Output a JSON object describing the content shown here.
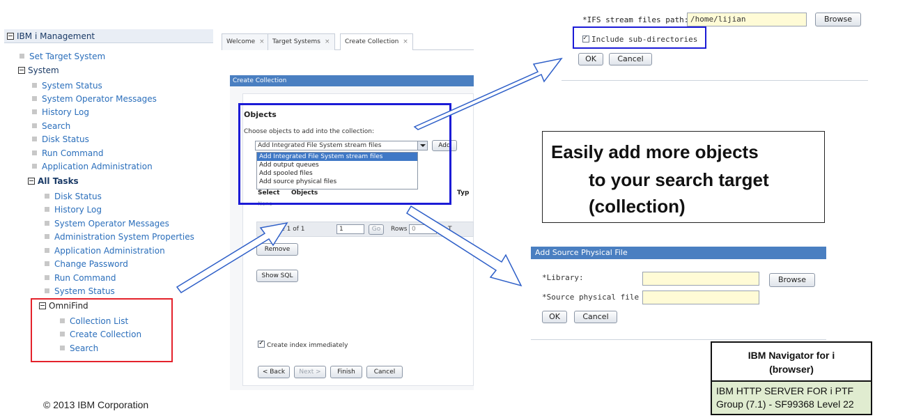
{
  "nav": {
    "header": "IBM i Management",
    "items": [
      {
        "label": "Set Target System",
        "kind": "link"
      },
      {
        "label": "System",
        "kind": "head"
      },
      {
        "label": "System Status",
        "kind": "link"
      },
      {
        "label": "System Operator Messages",
        "kind": "link"
      },
      {
        "label": "History Log",
        "kind": "link"
      },
      {
        "label": "Search",
        "kind": "link"
      },
      {
        "label": "Disk Status",
        "kind": "link"
      },
      {
        "label": "Run Command",
        "kind": "link"
      },
      {
        "label": "Application Administration",
        "kind": "link"
      },
      {
        "label": "All Tasks",
        "kind": "head"
      },
      {
        "label": "Disk Status",
        "kind": "link"
      },
      {
        "label": "History Log",
        "kind": "link"
      },
      {
        "label": "System Operator Messages",
        "kind": "link"
      },
      {
        "label": "Administration System Properties",
        "kind": "link"
      },
      {
        "label": "Application Administration",
        "kind": "link"
      },
      {
        "label": "Change Password",
        "kind": "link"
      },
      {
        "label": "Run Command",
        "kind": "link"
      },
      {
        "label": "System Status",
        "kind": "link"
      },
      {
        "label": "OmniFind",
        "kind": "head"
      },
      {
        "label": "Collection List",
        "kind": "link"
      },
      {
        "label": "Create Collection",
        "kind": "link"
      },
      {
        "label": "Search",
        "kind": "link"
      }
    ]
  },
  "wizard": {
    "tabs": [
      {
        "label": "Welcome"
      },
      {
        "label": "Target Systems"
      },
      {
        "label": "Create Collection"
      }
    ],
    "title": "Create Collection",
    "objects_heading": "Objects",
    "choose_label": "Choose objects to add into the collection:",
    "select_value": "Add Integrated File System stream files",
    "add_label": "Add",
    "dropdown_options": [
      "Add Integrated File System stream files",
      "Add output queues",
      "Add spooled files",
      "Add source physical files"
    ],
    "table_headers": [
      "Select",
      "Objects",
      "Typ"
    ],
    "table_empty": "None",
    "pager": {
      "page_text": "Page 1 of 1",
      "page_input": "1",
      "go_label": "Go",
      "rows_label": "Rows",
      "rows_value": "0",
      "total_label": "T"
    },
    "remove_label": "Remove",
    "show_sql_label": "Show SQL",
    "create_index_label": "Create index immediately",
    "create_index_checked": true,
    "footer": {
      "back": "< Back",
      "next": "Next >",
      "finish": "Finish",
      "cancel": "Cancel"
    }
  },
  "ifs": {
    "label": "*IFS stream files path:",
    "path_value": "/home/lijian",
    "browse_label": "Browse",
    "include_subdirs_label": "Include sub-directories",
    "include_subdirs_checked": true,
    "ok_label": "OK",
    "cancel_label": "Cancel"
  },
  "callout": {
    "line1": "Easily add more objects",
    "line2": "to your search target",
    "line3": "(collection)"
  },
  "srcpf": {
    "title": "Add Source Physical File",
    "library_label": "*Library:",
    "library_value": "",
    "spf_label": "*Source physical file :",
    "spf_value": "",
    "browse_label": "Browse",
    "ok_label": "OK",
    "cancel_label": "Cancel"
  },
  "navinfo": {
    "title_line1": "IBM Navigator for i",
    "title_line2": "(browser)",
    "detail": "IBM HTTP SERVER FOR i PTF Group (7.1) - SF99368 Level 22"
  },
  "footer": {
    "copyright": "© 2013 IBM Corporation"
  },
  "colors": {
    "highlight_blue": "#1b1bd6",
    "highlight_red": "#e4222b",
    "title_bar": "#4a7fc1",
    "input_yellow": "#fffbd6",
    "info_green": "#e0ecd0"
  }
}
